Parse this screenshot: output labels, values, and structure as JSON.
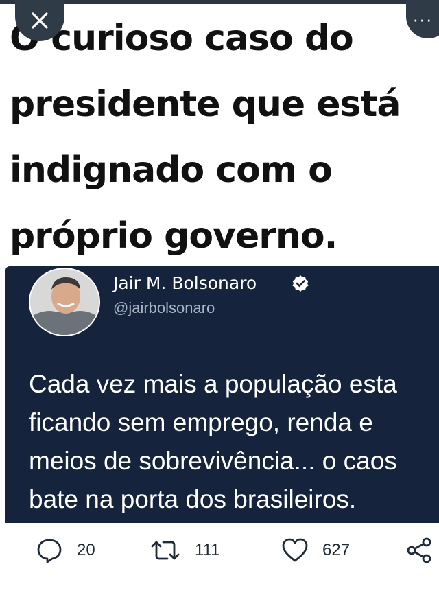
{
  "headline": {
    "lines": [
      "O curioso caso do",
      "presidente que está",
      "indignado com o",
      "próprio governo."
    ]
  },
  "controls": {
    "close_icon": "close-icon",
    "more_icon": "more-icon",
    "more_label": "···"
  },
  "tweet": {
    "author_name": "Jair M. Bolsonaro",
    "handle": "@jairbolsonaro",
    "verified": true,
    "lines": [
      "Cada vez mais a população esta",
      "ficando sem emprego, renda e",
      "meios de sobrevivência... o caos",
      "bate na porta dos brasileiros."
    ],
    "card_color": "#16233c"
  },
  "actions": {
    "replies": "20",
    "retweets": "111",
    "likes": "627"
  }
}
